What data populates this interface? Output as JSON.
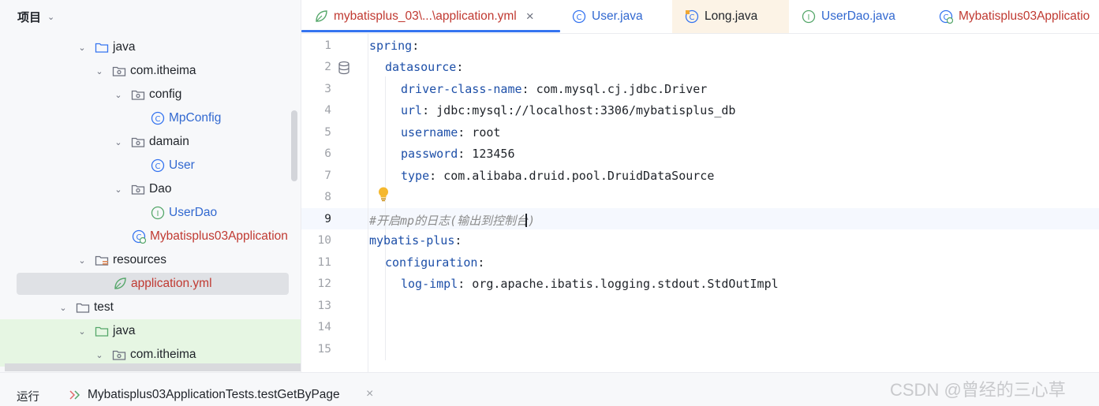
{
  "project_panel": {
    "title": "项目",
    "tree": [
      {
        "label": "java",
        "icon": "folder-icon",
        "color": "default",
        "expanded": true
      },
      {
        "label": "com.itheima",
        "icon": "package-icon",
        "color": "default",
        "expanded": true
      },
      {
        "label": "config",
        "icon": "package-icon",
        "color": "default",
        "expanded": true
      },
      {
        "label": "MpConfig",
        "icon": "class-icon",
        "color": "blue"
      },
      {
        "label": "damain",
        "icon": "package-icon",
        "color": "default",
        "expanded": true
      },
      {
        "label": "User",
        "icon": "class-icon",
        "color": "blue"
      },
      {
        "label": "Dao",
        "icon": "package-icon",
        "color": "default",
        "expanded": true
      },
      {
        "label": "UserDao",
        "icon": "interface-icon",
        "color": "blue"
      },
      {
        "label": "Mybatisplus03Application",
        "icon": "spring-app-icon",
        "color": "red"
      },
      {
        "label": "resources",
        "icon": "resources-folder-icon",
        "color": "default",
        "expanded": true
      },
      {
        "label": "application.yml",
        "icon": "spring-yml-icon",
        "color": "red",
        "selected": true
      },
      {
        "label": "test",
        "icon": "folder-icon",
        "color": "default",
        "expanded": true
      },
      {
        "label": "java",
        "icon": "test-folder-icon",
        "color": "default",
        "expanded": true
      },
      {
        "label": "com.itheima",
        "icon": "package-icon",
        "color": "default",
        "expanded": true
      }
    ]
  },
  "editor": {
    "tabs": [
      {
        "label": "mybatisplus_03\\...\\application.yml",
        "icon": "spring-yml-icon",
        "active": true,
        "close": "×"
      },
      {
        "label": "User.java",
        "icon": "class-icon"
      },
      {
        "label": "Long.java",
        "icon": "class-icon"
      },
      {
        "label": "UserDao.java",
        "icon": "interface-icon"
      },
      {
        "label": "Mybatisplus03Applicatio",
        "icon": "spring-app-icon"
      }
    ],
    "line_numbers": [
      "1",
      "2",
      "3",
      "4",
      "5",
      "6",
      "7",
      "8",
      "9",
      "10",
      "11",
      "12",
      "13",
      "14",
      "15"
    ],
    "current_line": "9",
    "lines": [
      {
        "key": "spring",
        "sep": ":",
        "value": ""
      },
      {
        "key": "datasource",
        "sep": ":",
        "value": ""
      },
      {
        "key": "driver-class-name",
        "sep": ":",
        "value": " com.mysql.cj.jdbc.Driver"
      },
      {
        "key": "url",
        "sep": ":",
        "value": " jdbc:mysql://localhost:3306/mybatisplus_db"
      },
      {
        "key": "username",
        "sep": ":",
        "value": " root"
      },
      {
        "key": "password",
        "sep": ":",
        "value": " 123456"
      },
      {
        "key": "type",
        "sep": ":",
        "value": " com.alibaba.druid.pool.DruidDataSource"
      },
      {
        "comment": ""
      },
      {
        "comment": "#开启mp的日志(输出到控制台)"
      },
      {
        "key": "mybatis-plus",
        "sep": ":",
        "value": ""
      },
      {
        "key": "configuration",
        "sep": ":",
        "value": ""
      },
      {
        "key": "log-impl",
        "sep": ":",
        "value": " org.apache.ibatis.logging.stdout.StdOutImpl"
      }
    ]
  },
  "bottom_bar": {
    "run_label": "运行",
    "run_config": "Mybatisplus03ApplicationTests.testGetByPage",
    "close": "×",
    "watermark": "CSDN @曾经的三心草"
  },
  "colors": {
    "accent": "#3574f0",
    "yaml_key": "#1d4fa8",
    "file_red": "#c03931",
    "class_blue": "#3168d0",
    "test_green_bg": "#e6f6e3"
  }
}
